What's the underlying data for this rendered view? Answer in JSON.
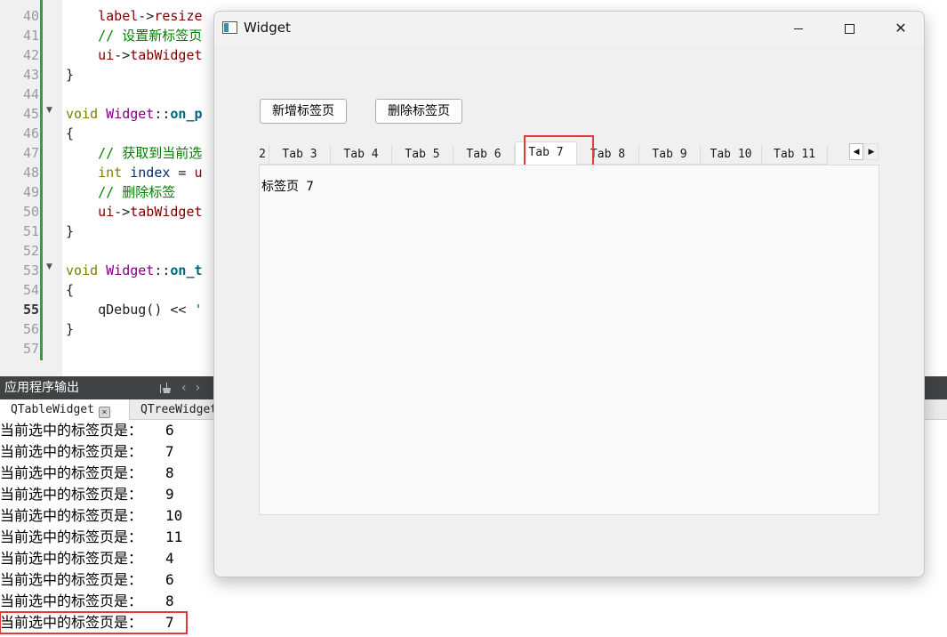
{
  "editor": {
    "lines": [
      {
        "num": "40",
        "tokens": [
          [
            "plain",
            "    "
          ],
          [
            "member",
            "label"
          ],
          [
            "op",
            "->"
          ],
          [
            "member",
            "resize"
          ]
        ]
      },
      {
        "num": "41",
        "tokens": [
          [
            "plain",
            "    "
          ],
          [
            "comment",
            "// 设置新标签页"
          ]
        ]
      },
      {
        "num": "42",
        "tokens": [
          [
            "plain",
            "    "
          ],
          [
            "member",
            "ui"
          ],
          [
            "op",
            "->"
          ],
          [
            "member",
            "tabWidget"
          ]
        ]
      },
      {
        "num": "43",
        "tokens": [
          [
            "op",
            "}"
          ]
        ]
      },
      {
        "num": "44",
        "tokens": []
      },
      {
        "num": "45",
        "fold": true,
        "tokens": [
          [
            "kw",
            "void"
          ],
          [
            "plain",
            " "
          ],
          [
            "class",
            "Widget"
          ],
          [
            "op",
            "::"
          ],
          [
            "fn",
            "on_p"
          ]
        ]
      },
      {
        "num": "46",
        "tokens": [
          [
            "op",
            "{"
          ]
        ]
      },
      {
        "num": "47",
        "tokens": [
          [
            "plain",
            "    "
          ],
          [
            "comment",
            "// 获取到当前选"
          ]
        ]
      },
      {
        "num": "48",
        "tokens": [
          [
            "plain",
            "    "
          ],
          [
            "kw",
            "int"
          ],
          [
            "plain",
            " "
          ],
          [
            "var",
            "index"
          ],
          [
            "plain",
            " = "
          ],
          [
            "member",
            "u"
          ]
        ]
      },
      {
        "num": "49",
        "tokens": [
          [
            "plain",
            "    "
          ],
          [
            "comment",
            "// 删除标签"
          ]
        ]
      },
      {
        "num": "50",
        "tokens": [
          [
            "plain",
            "    "
          ],
          [
            "member",
            "ui"
          ],
          [
            "op",
            "->"
          ],
          [
            "member",
            "tabWidget"
          ]
        ]
      },
      {
        "num": "51",
        "tokens": [
          [
            "op",
            "}"
          ]
        ]
      },
      {
        "num": "52",
        "tokens": []
      },
      {
        "num": "53",
        "fold": true,
        "tokens": [
          [
            "kw",
            "void"
          ],
          [
            "plain",
            " "
          ],
          [
            "class",
            "Widget"
          ],
          [
            "op",
            "::"
          ],
          [
            "fn",
            "on_t"
          ]
        ]
      },
      {
        "num": "54",
        "tokens": [
          [
            "op",
            "{"
          ]
        ]
      },
      {
        "num": "55",
        "current": true,
        "tokens": [
          [
            "plain",
            "    "
          ],
          [
            "plain",
            "qDebug() << "
          ],
          [
            "str",
            "'"
          ]
        ]
      },
      {
        "num": "56",
        "tokens": [
          [
            "op",
            "}"
          ]
        ]
      },
      {
        "num": "57",
        "tokens": []
      }
    ]
  },
  "output_pane": {
    "title": "应用程序输出",
    "tools": {
      "clean_icon": "broom-icon",
      "prev_glyph": "‹",
      "next_glyph": "›"
    },
    "tabs": [
      {
        "label": "QTableWidget",
        "closable": true,
        "close_glyph": "×"
      },
      {
        "label": "QTreeWidget"
      }
    ],
    "line_prefix": "当前选中的标签页是：",
    "values": [
      "6",
      "7",
      "8",
      "9",
      "10",
      "11",
      "4",
      "6",
      "8",
      "7"
    ],
    "highlighted_index": 9
  },
  "widget_window": {
    "title": "Widget",
    "window_icon": "qt-window-icon",
    "controls": {
      "minimize": "minimize-icon",
      "maximize": "maximize-icon",
      "close": "✕"
    },
    "add_tab_button": "新增标签页",
    "delete_tab_button": "删除标签页",
    "tabs": [
      "2",
      "Tab 3",
      "Tab 4",
      "Tab 5",
      "Tab 6",
      "Tab 7",
      "Tab 8",
      "Tab 9",
      "Tab 10",
      "Tab 11"
    ],
    "selected_tab": "Tab 7",
    "scroll_left_glyph": "◀",
    "scroll_right_glyph": "▶",
    "page_label": "标签页 7"
  },
  "colors": {
    "highlight_box": "#e53935",
    "output_header_bg": "#404244",
    "change_bar": "#2ea043",
    "keyword": "#808000",
    "comment": "#008000"
  }
}
